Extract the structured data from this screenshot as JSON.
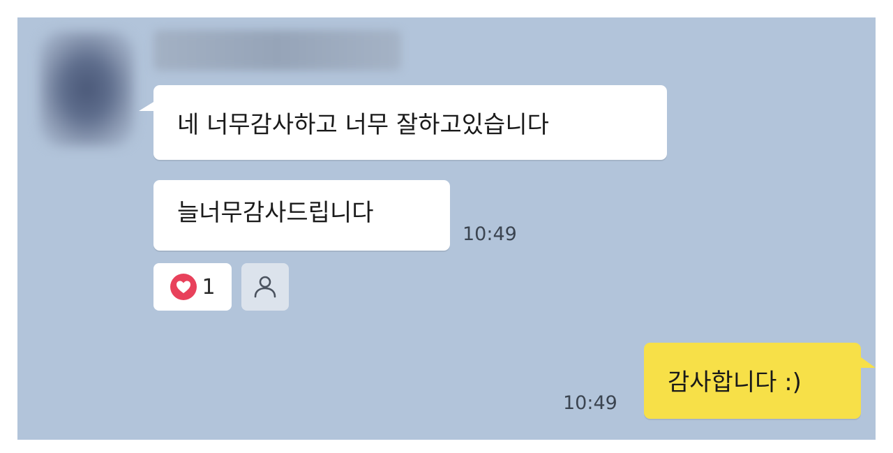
{
  "chat": {
    "incoming": {
      "messages": [
        {
          "text": "네 너무감사하고 너무 잘하고있습니다"
        },
        {
          "text": "늘너무감사드립니다",
          "time": "10:49"
        }
      ],
      "reactions": {
        "heart_count": "1",
        "heart_icon": "heart-icon",
        "add_icon": "person-icon"
      }
    },
    "outgoing": {
      "messages": [
        {
          "text": "감사합니다 :)",
          "time": "10:49"
        }
      ]
    }
  },
  "colors": {
    "chat_background": "#b2c4da",
    "incoming_bubble": "#ffffff",
    "outgoing_bubble": "#f7e048",
    "heart": "#e8415b"
  }
}
